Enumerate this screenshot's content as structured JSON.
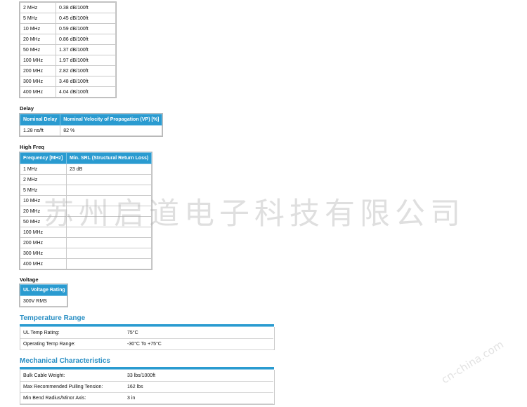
{
  "attenuation": {
    "rows": [
      [
        "2 MHz",
        "0.38 dB/100ft"
      ],
      [
        "5 MHz",
        "0.45 dB/100ft"
      ],
      [
        "10 MHz",
        "0.59 dB/100ft"
      ],
      [
        "20 MHz",
        "0.86 dB/100ft"
      ],
      [
        "50 MHz",
        "1.37 dB/100ft"
      ],
      [
        "100 MHz",
        "1.97 dB/100ft"
      ],
      [
        "200 MHz",
        "2.82 dB/100ft"
      ],
      [
        "300 MHz",
        "3.48 dB/100ft"
      ],
      [
        "400 MHz",
        "4.04 dB/100ft"
      ]
    ]
  },
  "delay": {
    "label": "Delay",
    "headers": [
      "Nominal Delay",
      "Nominal Velocity of Propagation (VP) [%]"
    ],
    "row": [
      "1.28 ns/ft",
      "82 %"
    ]
  },
  "high_freq": {
    "label": "High Freq",
    "headers": [
      "Frequency [MHz]",
      "Min. SRL (Structural Return Loss)"
    ],
    "rows": [
      [
        "1 MHz",
        "23 dB"
      ],
      [
        "2 MHz",
        ""
      ],
      [
        "5 MHz",
        ""
      ],
      [
        "10 MHz",
        ""
      ],
      [
        "20 MHz",
        ""
      ],
      [
        "50 MHz",
        ""
      ],
      [
        "100 MHz",
        ""
      ],
      [
        "200 MHz",
        ""
      ],
      [
        "300 MHz",
        ""
      ],
      [
        "400 MHz",
        ""
      ]
    ]
  },
  "voltage": {
    "label": "Voltage",
    "header": "UL Voltage Rating",
    "value": "300V RMS"
  },
  "temperature": {
    "title": "Temperature Range",
    "rows": [
      [
        "UL Temp Rating:",
        "75°C"
      ],
      [
        "Operating Temp Range:",
        "-30°C To +75°C"
      ]
    ]
  },
  "mechanical": {
    "title": "Mechanical Characteristics",
    "rows": [
      [
        "Bulk Cable Weight:",
        "33 lbs/1000ft"
      ],
      [
        "Max Recommended Pulling Tension:",
        "162 lbs"
      ],
      [
        "Min Bend Radius/Minor Axis:",
        "3 in"
      ]
    ]
  },
  "watermark": "苏州启道电子科技有限公司",
  "watermark_url": "cn-china.com",
  "colors": {
    "header_blue": "#2a9bd0",
    "title_blue": "#2a8fc4",
    "border_gray": "#c9c9c9"
  }
}
